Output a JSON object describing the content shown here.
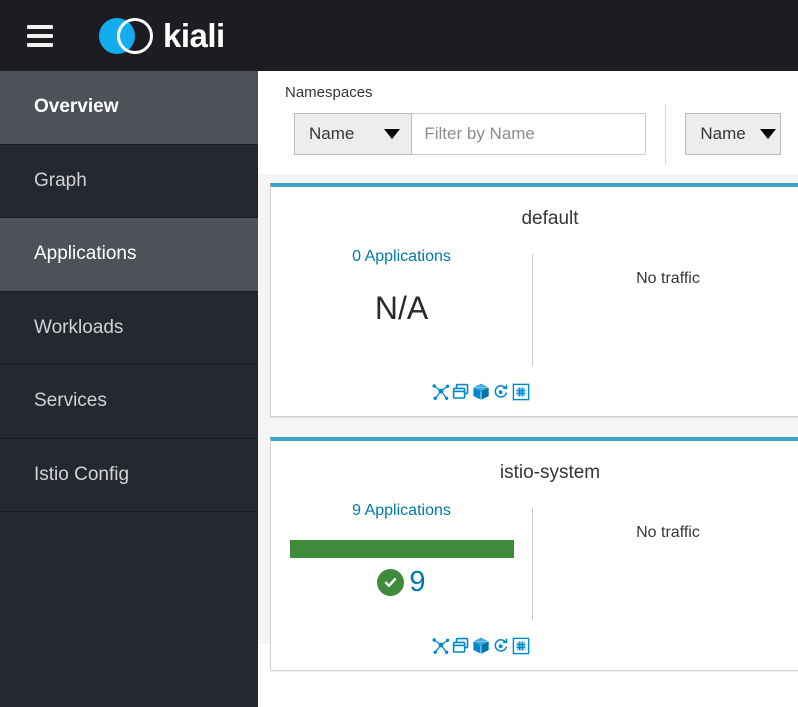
{
  "masthead": {
    "menu_icon": "hamburger-menu-icon",
    "logo_icon": "kiali-logo-icon",
    "brand_name": "kiali"
  },
  "sidebar": {
    "items": [
      {
        "label": "Overview",
        "state": "active",
        "icon": "overview-icon"
      },
      {
        "label": "Graph",
        "state": "default",
        "icon": "graph-icon"
      },
      {
        "label": "Applications",
        "state": "hovered",
        "icon": "applications-icon"
      },
      {
        "label": "Workloads",
        "state": "default",
        "icon": "workloads-icon"
      },
      {
        "label": "Services",
        "state": "default",
        "icon": "services-icon"
      },
      {
        "label": "Istio Config",
        "state": "default",
        "icon": "istio-config-icon"
      }
    ]
  },
  "main": {
    "section_title": "Namespaces",
    "toolbar": {
      "filter_select_value": "Name",
      "filter_input_value": "",
      "filter_input_placeholder": "Filter by Name",
      "sort_select_value": "Name",
      "caret_icon": "chevron-down-icon"
    },
    "cards": [
      {
        "namespace": "default",
        "apps_link": "0 Applications",
        "health_display": "N/A",
        "has_health_bar": false,
        "health_bar_color": "",
        "health_count": "",
        "health_status_icon": "",
        "traffic": "No traffic",
        "actions": [
          {
            "icon": "graph-topology-icon",
            "label": "Graph"
          },
          {
            "icon": "applications-icon",
            "label": "Applications"
          },
          {
            "icon": "workloads-cube-icon",
            "label": "Workloads"
          },
          {
            "icon": "services-icon",
            "label": "Services"
          },
          {
            "icon": "istio-config-icon",
            "label": "Istio Config"
          }
        ]
      },
      {
        "namespace": "istio-system",
        "apps_link": "9 Applications",
        "health_display": "",
        "has_health_bar": true,
        "health_bar_color": "#3f8a3b",
        "health_count": "9",
        "health_status_icon": "check-circle-icon",
        "traffic": "No traffic",
        "actions": [
          {
            "icon": "graph-topology-icon",
            "label": "Graph"
          },
          {
            "icon": "applications-icon",
            "label": "Applications"
          },
          {
            "icon": "workloads-cube-icon",
            "label": "Workloads"
          },
          {
            "icon": "services-icon",
            "label": "Services"
          },
          {
            "icon": "istio-config-icon",
            "label": "Istio Config"
          }
        ]
      }
    ]
  },
  "colors": {
    "masthead_bg": "#1b1d21",
    "sidebar_bg": "#252830",
    "sidebar_active_bg": "#4d5258",
    "card_accent": "#39a5c4",
    "link": "#0079ad",
    "health_ok": "#3f8a3b",
    "brand_blue": "#13adee"
  }
}
